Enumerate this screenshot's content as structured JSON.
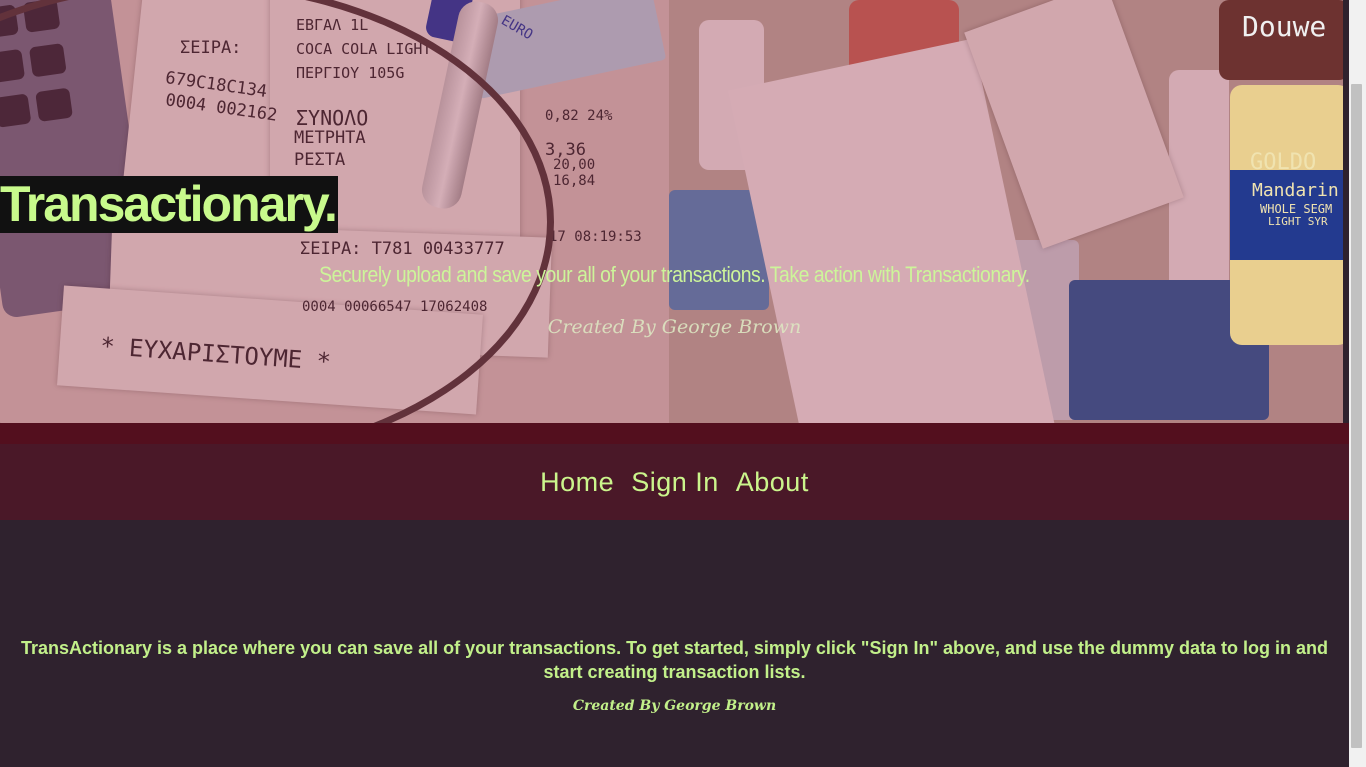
{
  "hero": {
    "title": "Transactionary.",
    "subtitle": "Securely upload and save your all of your transactions. Take action with Transactionary.",
    "credit": "Created By George Brown",
    "receipt_texts": [
      "ΣΕΙΡΑ:",
      "679C18C134",
      "0004 002162",
      "ΣΥΝΟΛΟ",
      "ΜΕΤΡΗΤΑ",
      "ΡΕΣΤΑ",
      "3,36",
      "20,00",
      "16,84",
      "COCA COLA LIGHT",
      "ΕΒΓΑΛ 1L",
      "ΠΕΡΓΙΟΥ 105G",
      "ΣΕΙΡΑ: T781 00433777",
      "0004 00066547 17062408",
      "* ΕΥΧΑΡΙΣΤΟΥΜΕ *",
      "0,82 24%",
      "17 08:19:53",
      "GOLDO",
      "Mandarin",
      "WHOLE SEGM",
      "LIGHT SYR",
      "Douwe",
      "EURO"
    ]
  },
  "nav": {
    "items": [
      {
        "label": "Home"
      },
      {
        "label": "Sign In"
      },
      {
        "label": "About"
      }
    ]
  },
  "main": {
    "description": "TransActionary is a place where you can save all of your transactions. To get started, simply click \"Sign In\" above, and use the dummy data to log in and start creating transaction lists.",
    "credit": "Created By George Brown"
  },
  "colors": {
    "accent_green": "#c8fa8c",
    "nav_bg": "#4a1828",
    "nav_top_bg": "#530f1e",
    "page_bg": "#2f222e",
    "title_bg": "#111111"
  }
}
